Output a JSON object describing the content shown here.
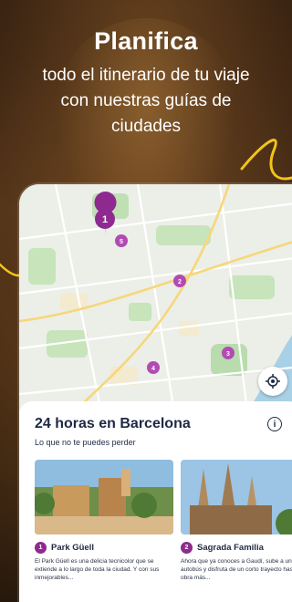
{
  "headline": {
    "title": "Planifica",
    "subtitle": "todo el itinerario de tu viaje con nuestras guías de ciudades"
  },
  "map": {
    "pins": [
      {
        "label": "1",
        "size": "large"
      },
      {
        "label": "5",
        "size": "small"
      },
      {
        "label": "2",
        "size": "small"
      },
      {
        "label": "3",
        "size": "small"
      },
      {
        "label": "4",
        "size": "small"
      }
    ],
    "locate_icon": "target-icon"
  },
  "guide": {
    "title": "24 horas en Barcelona",
    "info_label": "i",
    "subtitle": "Lo que no te puedes perder",
    "cards": [
      {
        "number": "1",
        "title": "Park Güell",
        "description": "El Park Güell es una delicia tecnicolor que se extiende a lo largo de toda la ciudad. Y con sus inmejorables..."
      },
      {
        "number": "2",
        "title": "Sagrada Familia",
        "description": "Ahora que ya conoces a Gaudí, sube a un autobús y disfruta de un corto trayecto hasta su obra más..."
      }
    ]
  },
  "colors": {
    "accent_yellow": "#f2c418",
    "pin_purple": "#8e2a8f",
    "text_dark": "#1d2a44"
  }
}
